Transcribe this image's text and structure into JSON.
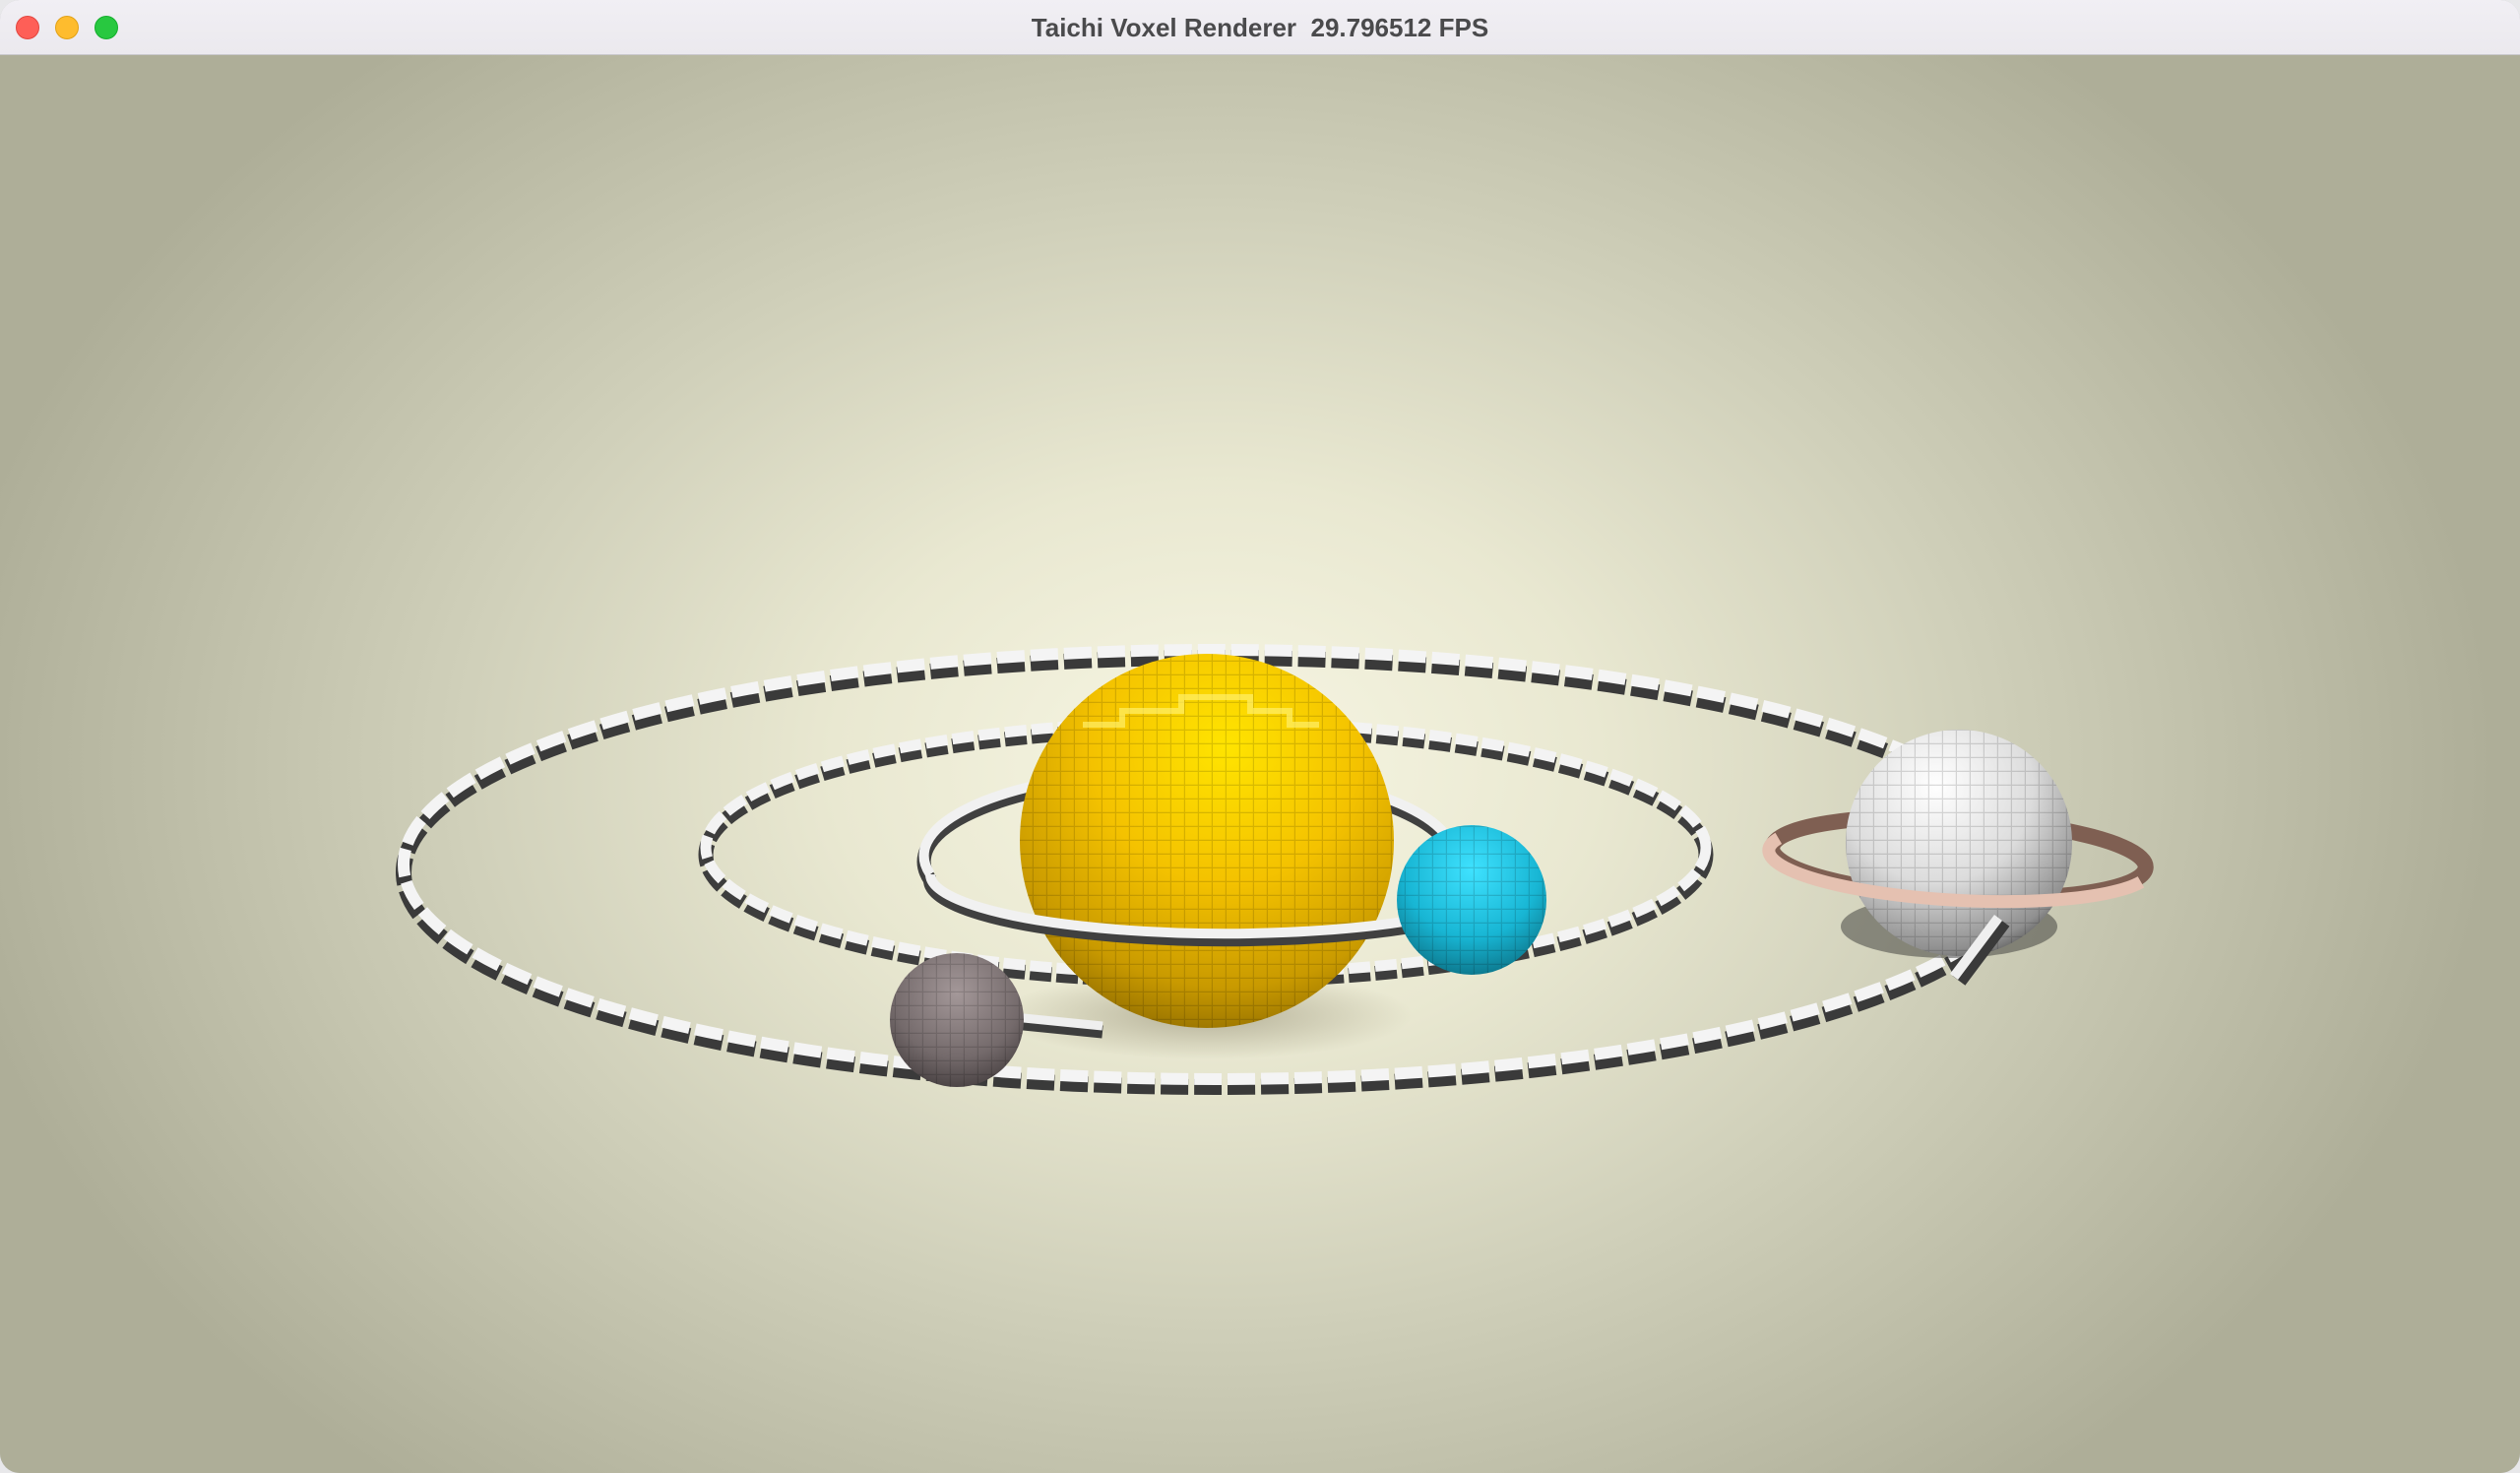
{
  "window": {
    "title": "Taichi Voxel Renderer  29.796512 FPS",
    "controls": {
      "close_color": "#fe5f57",
      "minimize_color": "#febc2e",
      "maximize_color": "#28c840"
    }
  },
  "scene": {
    "background_color": "#e9e8d1",
    "bodies": [
      {
        "name": "sun",
        "color": "#f0c000"
      },
      {
        "name": "cyan-planet",
        "color": "#1ec3df"
      },
      {
        "name": "gray-moon",
        "color": "#7a6f70"
      },
      {
        "name": "ringed-planet",
        "color": "#e0e0e0",
        "ring_color": "#e3bfb0"
      }
    ],
    "orbits": [
      {
        "name": "inner-orbit",
        "color": "#f2f2f2"
      },
      {
        "name": "middle-orbit",
        "color": "#f2f2f2"
      },
      {
        "name": "outer-orbit",
        "color": "#f2f2f2"
      }
    ]
  }
}
